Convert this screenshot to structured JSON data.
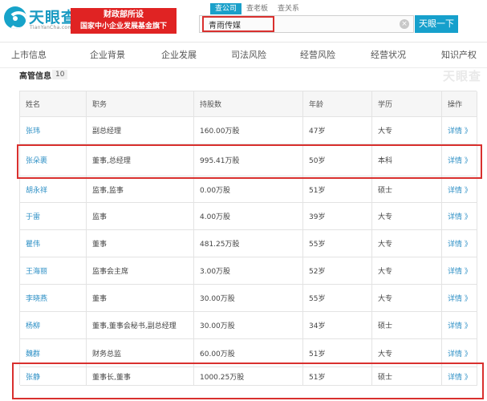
{
  "brand": {
    "name": "天眼查",
    "domain": "TianYanCha.com",
    "banner_line1": "财政部所设",
    "banner_line2": "国家中小企业发展基金旗下"
  },
  "search": {
    "tabs": [
      {
        "label": "查公司",
        "active": true
      },
      {
        "label": "查老板",
        "active": false
      },
      {
        "label": "查关系",
        "active": false
      }
    ],
    "query": "青雨传媒",
    "clear_icon": "×",
    "button_label": "天眼一下"
  },
  "nav": {
    "items": [
      "上市信息",
      "企业背景",
      "企业发展",
      "司法风险",
      "经营风险",
      "经营状况",
      "知识产权"
    ]
  },
  "section": {
    "title": "高管信息",
    "count": "10",
    "watermark": "天眼查"
  },
  "table": {
    "headers": [
      "姓名",
      "职务",
      "持股数",
      "年龄",
      "学历",
      "操作"
    ],
    "rows": [
      {
        "name": "张玮",
        "position": "副总经理",
        "shares": "160.00万股",
        "age": "47岁",
        "education": "大专",
        "action": "详情 》",
        "highlighted": false
      },
      {
        "name": "张朵裹",
        "position": "董事,总经理",
        "shares": "995.41万股",
        "age": "50岁",
        "education": "本科",
        "action": "详情 》",
        "highlighted": true
      },
      {
        "name": "胡永祥",
        "position": "监事,监事",
        "shares": "0.00万股",
        "age": "51岁",
        "education": "硕士",
        "action": "详情 》",
        "highlighted": false
      },
      {
        "name": "于雷",
        "position": "监事",
        "shares": "4.00万股",
        "age": "39岁",
        "education": "大专",
        "action": "详情 》",
        "highlighted": false
      },
      {
        "name": "瞿伟",
        "position": "董事",
        "shares": "481.25万股",
        "age": "55岁",
        "education": "大专",
        "action": "详情 》",
        "highlighted": false
      },
      {
        "name": "王海丽",
        "position": "监事会主席",
        "shares": "3.00万股",
        "age": "52岁",
        "education": "大专",
        "action": "详情 》",
        "highlighted": false
      },
      {
        "name": "李晓燕",
        "position": "董事",
        "shares": "30.00万股",
        "age": "55岁",
        "education": "大专",
        "action": "详情 》",
        "highlighted": false
      },
      {
        "name": "杨柳",
        "position": "董事,董事会秘书,副总经理",
        "shares": "30.00万股",
        "age": "34岁",
        "education": "硕士",
        "action": "详情 》",
        "highlighted": false
      },
      {
        "name": "魏群",
        "position": "财务总监",
        "shares": "60.00万股",
        "age": "51岁",
        "education": "大专",
        "action": "详情 》",
        "highlighted": false
      },
      {
        "name": "张静",
        "position": "董事长,董事",
        "shares": "1000.25万股",
        "age": "51岁",
        "education": "硕士",
        "action": "详情 》",
        "highlighted": true
      }
    ]
  },
  "colors": {
    "accent": "#16a0cc",
    "highlight": "#d9302e",
    "banner": "#e02323"
  }
}
